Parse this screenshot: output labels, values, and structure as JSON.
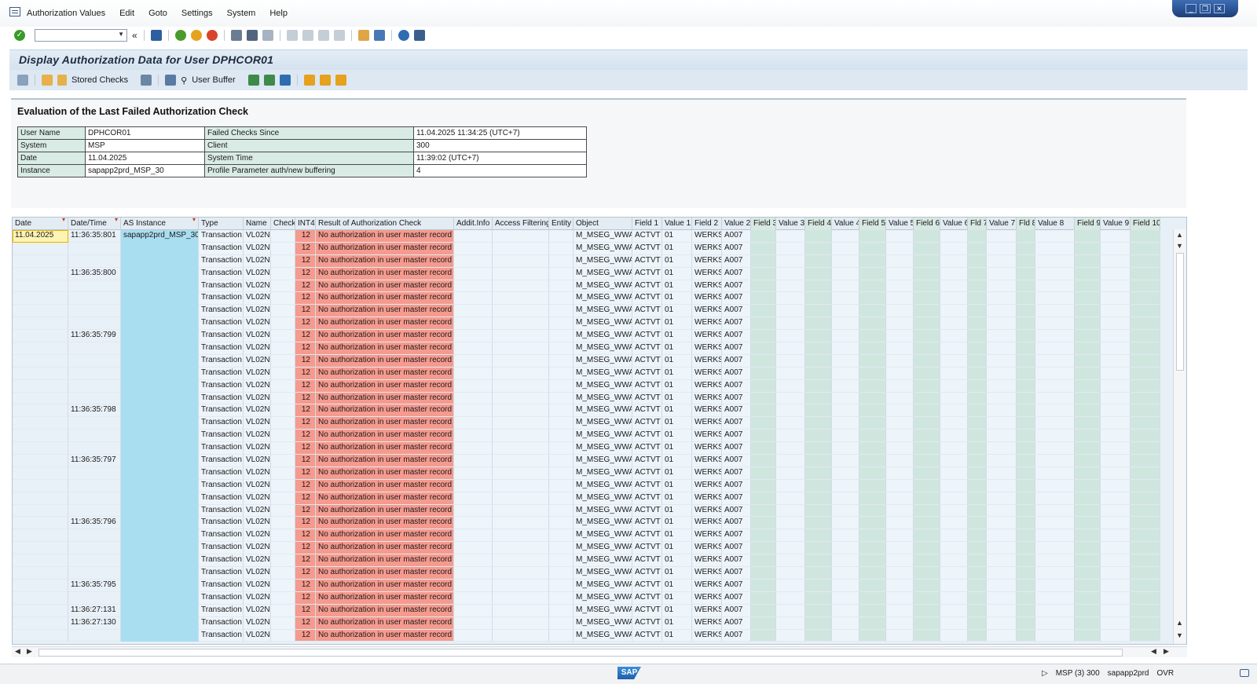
{
  "menu": [
    "Authorization Values",
    "Edit",
    "Goto",
    "Settings",
    "System",
    "Help"
  ],
  "title": "Display Authorization Data for User DPHCOR01",
  "app_toolbar": {
    "stored_checks": "Stored Checks",
    "user_buffer": "User Buffer"
  },
  "section_title": "Evaluation of the Last Failed Authorization Check",
  "info": [
    {
      "label1": "User Name",
      "value1": "DPHCOR01",
      "label2": "Failed Checks Since",
      "value2": "11.04.2025 11:34:25 (UTC+7)"
    },
    {
      "label1": "System",
      "value1": "MSP",
      "label2": "Client",
      "value2": "300"
    },
    {
      "label1": "Date",
      "value1": "11.04.2025",
      "label2": "System Time",
      "value2": "11:39:02 (UTC+7)"
    },
    {
      "label1": "Instance",
      "value1": "sapapp2prd_MSP_30",
      "label2": "Profile Parameter auth/new buffering",
      "value2": "4"
    }
  ],
  "grid": {
    "columns": [
      "Date",
      "Date/Time",
      "AS Instance",
      "Type",
      "Name",
      "Check",
      "INT4",
      "Result of Authorization Check",
      "Addit.Info",
      "Access Filtering",
      "Entity",
      "Object",
      "Field 1",
      "Value 1",
      "Field 2",
      "Value 2",
      "Field 3",
      "Value 3",
      "Field 4",
      "Value 4",
      "Field 5",
      "Value 5",
      "Field 6",
      "Value 6",
      "Fld 7",
      "Value 7",
      "Fld 8",
      "Value 8",
      "Field 9",
      "Value 9",
      "Field 10"
    ],
    "row_template": {
      "type": "Transaction",
      "name": "VL02N",
      "int4": "12",
      "result": "No authorization in user master record",
      "object": "M_MSEG_WWA",
      "field1": "ACTVT",
      "value1": "01",
      "field2": "WERKS",
      "value2": "A007"
    },
    "first_date": "11.04.2025",
    "first_instance": "sapapp2prd_MSP_30",
    "times": [
      {
        "row": 0,
        "time": "11:36:35:801"
      },
      {
        "row": 3,
        "time": "11:36:35:800"
      },
      {
        "row": 8,
        "time": "11:36:35:799"
      },
      {
        "row": 14,
        "time": "11:36:35:798"
      },
      {
        "row": 18,
        "time": "11:36:35:797"
      },
      {
        "row": 23,
        "time": "11:36:35:796"
      },
      {
        "row": 28,
        "time": "11:36:35:795"
      },
      {
        "row": 30,
        "time": "11:36:27:131"
      },
      {
        "row": 31,
        "time": "11:36:27:130"
      }
    ],
    "row_count": 33
  },
  "status": {
    "system": "MSP (3) 300",
    "server": "sapapp2prd",
    "mode": "OVR",
    "logo": "SAP"
  }
}
